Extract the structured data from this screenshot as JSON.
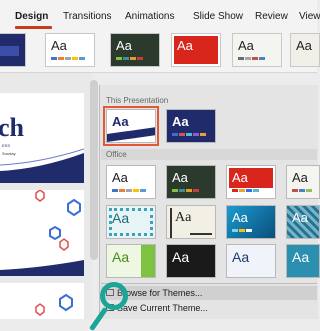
{
  "ribbon": {
    "tabs": [
      {
        "label": "Design",
        "active": true
      },
      {
        "label": "Transitions"
      },
      {
        "label": "Animations"
      },
      {
        "label": "Slide Show"
      },
      {
        "label": "Review"
      },
      {
        "label": "View"
      }
    ],
    "theme_samples": [
      "Aa",
      "Aa",
      "Aa",
      "Aa",
      "Aa"
    ]
  },
  "slides": {
    "first_slide_big_text": "ch",
    "first_slide_small_text": "ESS",
    "first_slide_tiny_text": "Sunday"
  },
  "panel": {
    "this_presentation_label": "This Presentation",
    "this_presentation_themes": [
      "Aa",
      "Aa"
    ],
    "office_label": "Office",
    "office_themes": [
      "Aa",
      "Aa",
      "Aa",
      "Aa",
      "Aa",
      "Aa",
      "Aa",
      "Aa",
      "Aa",
      "Aa",
      "Aa",
      "Aa"
    ],
    "menu": {
      "browse_label": "Browse for Themes...",
      "save_label": "Save Current Theme..."
    }
  },
  "colors": {
    "accent_tab": "#c43e1c",
    "selected_border": "#e05a3a",
    "magnifier": "#1aa597",
    "navy": "#1f2b6b"
  }
}
